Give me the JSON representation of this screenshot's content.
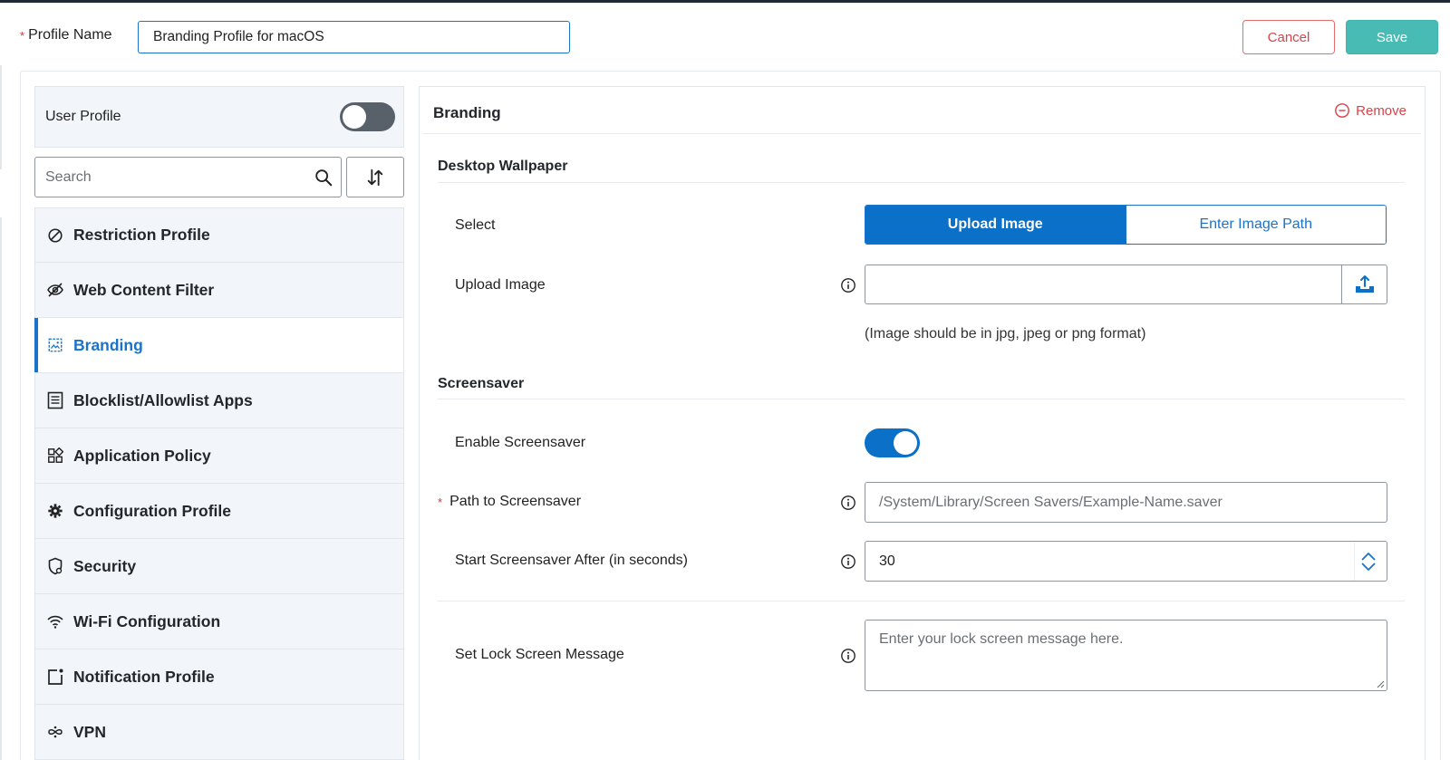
{
  "header": {
    "profile_name_label": "Profile Name",
    "required_marker": "*",
    "profile_name_value": "Branding Profile for macOS",
    "cancel_label": "Cancel",
    "save_label": "Save"
  },
  "sidebar": {
    "user_profile_label": "User Profile",
    "user_profile_enabled": false,
    "search_placeholder": "Search",
    "items": [
      {
        "label": "Restriction Profile",
        "icon": "restriction-icon"
      },
      {
        "label": "Web Content Filter",
        "icon": "eye-slash-icon"
      },
      {
        "label": "Branding",
        "icon": "branding-image-icon",
        "active": true
      },
      {
        "label": "Blocklist/Allowlist Apps",
        "icon": "list-icon"
      },
      {
        "label": "Application Policy",
        "icon": "apps-grid-icon"
      },
      {
        "label": "Configuration Profile",
        "icon": "gear-icon"
      },
      {
        "label": "Security",
        "icon": "shield-icon"
      },
      {
        "label": "Wi-Fi Configuration",
        "icon": "wifi-icon"
      },
      {
        "label": "Notification Profile",
        "icon": "notification-icon"
      },
      {
        "label": "VPN",
        "icon": "vpn-icon"
      }
    ]
  },
  "panel": {
    "title": "Branding",
    "remove_label": "Remove",
    "wallpaper": {
      "section_title": "Desktop Wallpaper",
      "select_label": "Select",
      "options": [
        "Upload Image",
        "Enter Image Path"
      ],
      "selected": "Upload Image",
      "upload_label": "Upload Image",
      "upload_hint": "(Image should be in jpg, jpeg or png format)"
    },
    "screensaver": {
      "section_title": "Screensaver",
      "enable_label": "Enable Screensaver",
      "enabled": true,
      "path_label": "Path to Screensaver",
      "path_placeholder": "/System/Library/Screen Savers/Example-Name.saver",
      "start_after_label": "Start Screensaver After (in seconds)",
      "start_after_value": "30",
      "lock_message_label": "Set Lock Screen Message",
      "lock_message_placeholder": "Enter your lock screen message here."
    }
  },
  "colors": {
    "accent": "#0a70c8",
    "save": "#47bbb4",
    "danger": "#d9434a"
  }
}
